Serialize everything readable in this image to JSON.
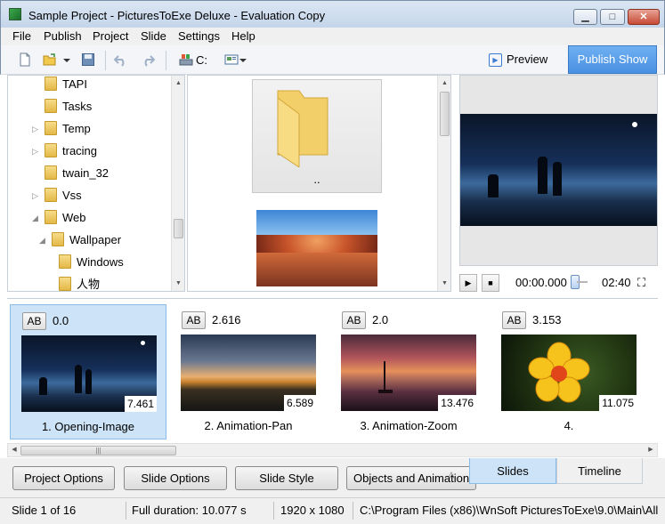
{
  "window": {
    "title": "Sample Project - PicturesToExe Deluxe - Evaluation Copy"
  },
  "menu": [
    "File",
    "Publish",
    "Project",
    "Slide",
    "Settings",
    "Help"
  ],
  "toolbar": {
    "drive_label": "C:",
    "preview_label": "Preview",
    "publish_label": "Publish Show"
  },
  "tree": {
    "items": [
      {
        "label": "TAPI",
        "expander": "none"
      },
      {
        "label": "Tasks",
        "expander": "none"
      },
      {
        "label": "Temp",
        "expander": "collapsed"
      },
      {
        "label": "tracing",
        "expander": "collapsed"
      },
      {
        "label": "twain_32",
        "expander": "none"
      },
      {
        "label": "Vss",
        "expander": "collapsed"
      },
      {
        "label": "Web",
        "expander": "expanded"
      },
      {
        "label": "Wallpaper",
        "expander": "expanded"
      },
      {
        "label": "Windows",
        "expander": "none"
      },
      {
        "label": "人物",
        "expander": "none"
      }
    ]
  },
  "files": {
    "parent_label": ".."
  },
  "player": {
    "current_time": "00:00.000",
    "total_time": "02:40"
  },
  "slides": [
    {
      "ab": "AB",
      "transition": "0.0",
      "duration": "7.461",
      "name": "1. Opening-Image",
      "selected": true
    },
    {
      "ab": "AB",
      "transition": "2.616",
      "duration": "6.589",
      "name": "2. Animation-Pan",
      "selected": false
    },
    {
      "ab": "AB",
      "transition": "2.0",
      "duration": "13.476",
      "name": "3. Animation-Zoom",
      "selected": false
    },
    {
      "ab": "AB",
      "transition": "3.153",
      "duration": "11.075",
      "name": "4.",
      "selected": false
    }
  ],
  "buttons": {
    "project_options": "Project Options",
    "slide_options": "Slide Options",
    "slide_style": "Slide Style",
    "objects_animation": "Objects and Animation"
  },
  "tabs": {
    "slides": "Slides",
    "timeline": "Timeline"
  },
  "status": {
    "slide_position": "Slide 1 of 16",
    "full_duration": "Full duration: 10.077 s",
    "resolution": "1920 x 1080",
    "path": "C:\\Program Files (x86)\\WnSoft PicturesToExe\\9.0\\Main\\All"
  },
  "colors": {
    "accent": "#4a90e2",
    "selection": "#cde3f7"
  }
}
